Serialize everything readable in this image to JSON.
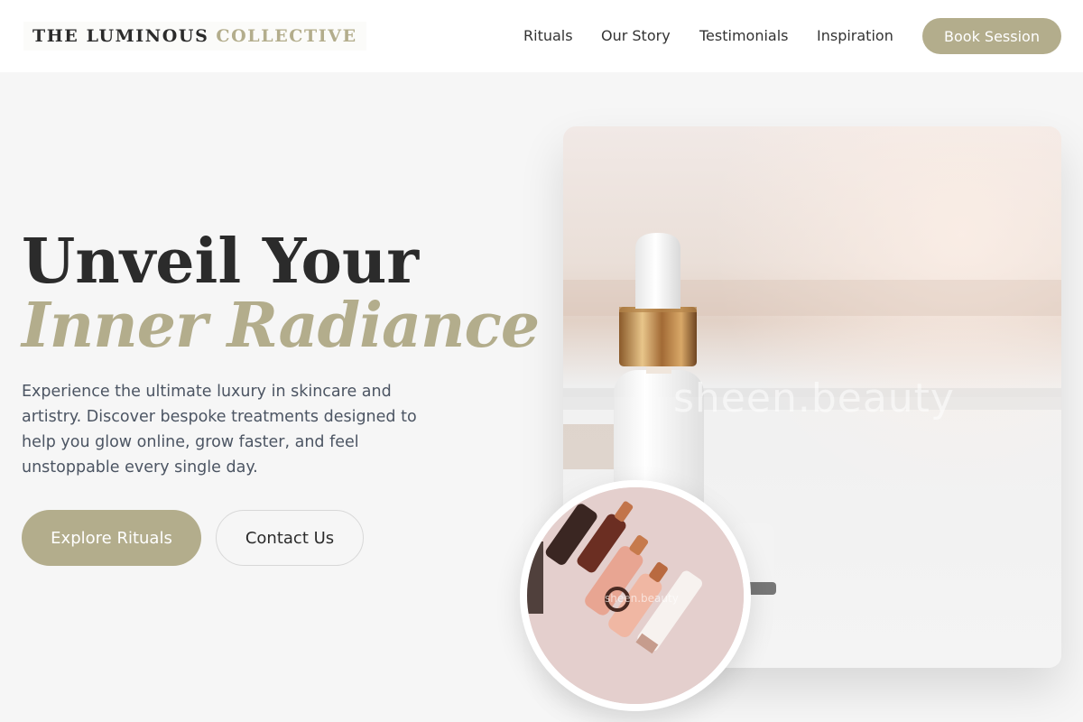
{
  "brand": {
    "name_part1": "THE LUMINOUS",
    "name_part2": "COLLECTIVE",
    "accent_color": "#b3ad8c"
  },
  "nav": {
    "items": [
      "Rituals",
      "Our Story",
      "Testimonials",
      "Inspiration"
    ],
    "cta_label": "Book Session"
  },
  "hero": {
    "title_line1": "Unveil Your",
    "title_line2": "Inner Radiance",
    "description": "Experience the ultimate luxury in skincare and artistry. Discover bespoke treatments designed to help you glow online, grow faster, and feel unstoppable every single day.",
    "primary_button": "Explore Rituals",
    "secondary_button": "Contact Us"
  },
  "images": {
    "main_watermark": "sheen.beauty",
    "circle_watermark": "sheen.beauty",
    "main_icon": "serum-dropper-bottle-photo",
    "circle_icon": "cosmetic-bottles-photo"
  }
}
